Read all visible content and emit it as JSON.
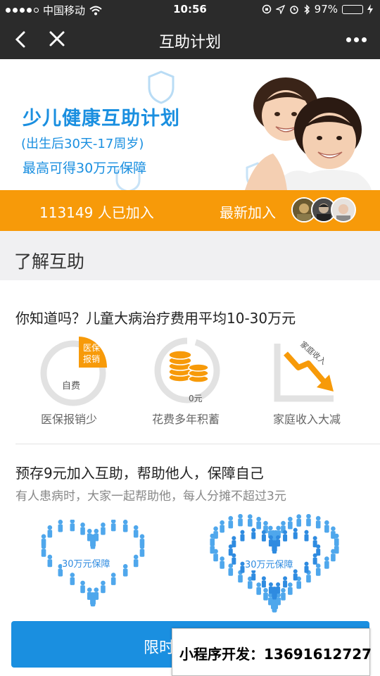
{
  "status_bar": {
    "carrier": "中国移动",
    "time": "10:56",
    "battery": "97%",
    "battery_level": 0.97
  },
  "nav": {
    "title": "互助计划"
  },
  "hero": {
    "title": "少儿健康互助计划",
    "subtitle": "(出生后30天-17周岁)",
    "benefit": "最高可得30万元保障"
  },
  "band": {
    "member_count": "113149 人已加入",
    "newest_label": "最新加入"
  },
  "section": {
    "title": "了解互助"
  },
  "info": {
    "question": "你知道吗？儿童大病治疗费用平均10-30万元",
    "icons": [
      {
        "label": "医保报销少",
        "inner_a": "医保",
        "inner_b": "报销",
        "inner_c": "自费"
      },
      {
        "label": "花费多年积蓄",
        "inner_a": "0元"
      },
      {
        "label": "家庭收入大减",
        "inner_a": "家庭收入"
      }
    ],
    "plan_title": "预存9元加入互助，帮助他人，保障自己",
    "plan_sub": "有人患病时，大家一起帮助他，每人分摊不超过3元",
    "heart_label_1": "30万元保障",
    "heart_label_2": "30万元保障"
  },
  "bottom": {
    "button_label": "限时",
    "watermark": "小程序开发：13691612727"
  },
  "colors": {
    "accent_blue": "#1a8fe0",
    "band_orange": "#f79a09",
    "navbar": "#2b2b2b",
    "battery_green": "#4cd964"
  }
}
